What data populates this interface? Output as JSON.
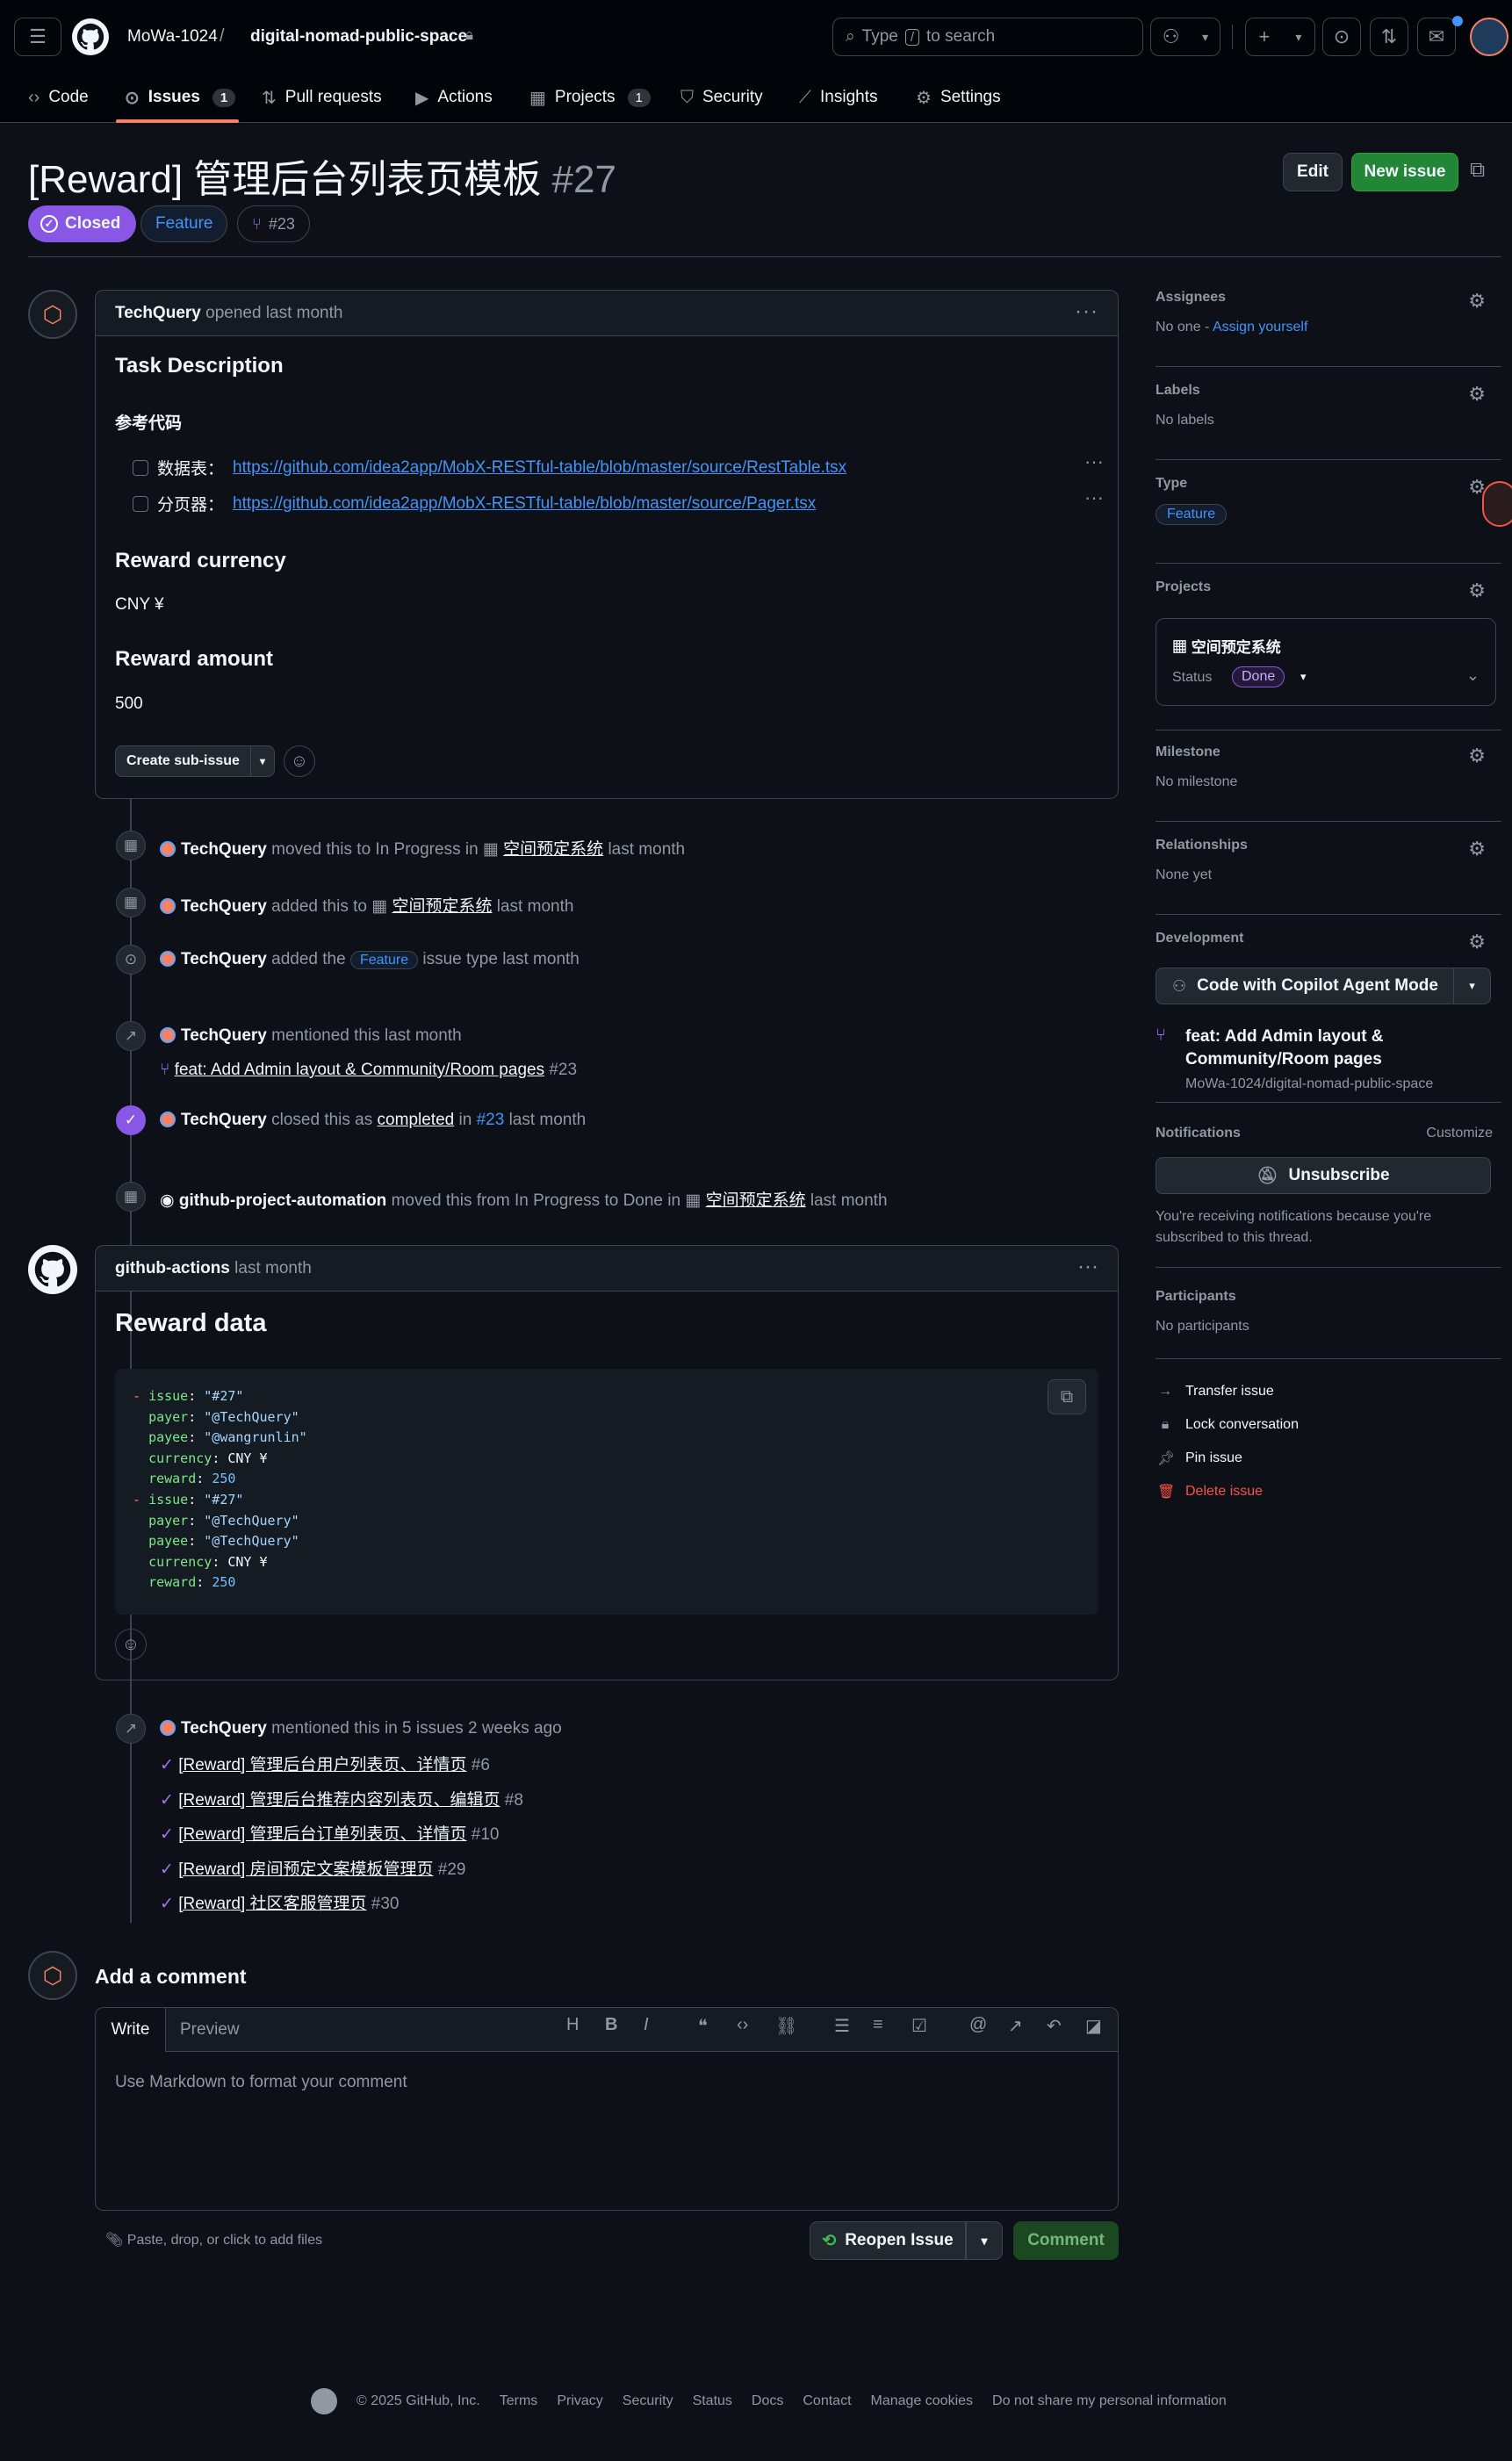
{
  "header": {
    "owner": "MoWa-1024",
    "separator": "/",
    "repo": "digital-nomad-public-space",
    "search_prefix": "Type",
    "search_key": "/",
    "search_suffix": "to search"
  },
  "tabs": [
    {
      "label": "Code",
      "icon": "code-icon"
    },
    {
      "label": "Issues",
      "count": "1",
      "icon": "issue-icon"
    },
    {
      "label": "Pull requests",
      "icon": "pr-icon"
    },
    {
      "label": "Actions",
      "icon": "play-icon"
    },
    {
      "label": "Projects",
      "count": "1",
      "icon": "table-icon"
    },
    {
      "label": "Security",
      "icon": "shield-icon"
    },
    {
      "label": "Insights",
      "icon": "graph-icon"
    },
    {
      "label": "Settings",
      "icon": "gear-icon"
    }
  ],
  "issue": {
    "title": "[Reward] 管理后台列表页模板",
    "number": "#27",
    "state": "Closed",
    "type_label": "Feature",
    "linked_pr": "#23",
    "edit_label": "Edit",
    "new_issue_label": "New issue"
  },
  "first_comment": {
    "author": "TechQuery",
    "meta": "opened last month",
    "h_task": "Task Description",
    "h_ref": "参考代码",
    "tasks": [
      {
        "label": "数据表：",
        "url": "https://github.com/idea2app/MobX-RESTful-table/blob/master/source/RestTable.tsx"
      },
      {
        "label": "分页器：",
        "url": "https://github.com/idea2app/MobX-RESTful-table/blob/master/source/Pager.tsx"
      }
    ],
    "h_currency": "Reward currency",
    "currency": "CNY ¥",
    "h_amount": "Reward amount",
    "amount": "500",
    "sub_issue_label": "Create sub-issue"
  },
  "timeline": {
    "ev1": {
      "actor": "TechQuery",
      "pre": "moved this to In Progress in",
      "project": "空间预定系统",
      "post": "last month"
    },
    "ev2": {
      "actor": "TechQuery",
      "pre": "added this to",
      "project": "空间预定系统",
      "post": "last month"
    },
    "ev3": {
      "actor": "TechQuery",
      "pre": "added the",
      "badge": "Feature",
      "post": "issue type last month"
    },
    "ev4": {
      "actor": "TechQuery",
      "pre": "mentioned this last month",
      "pr_title": "feat: Add Admin layout & Community/Room pages",
      "pr_num": "#23"
    },
    "ev5": {
      "actor": "TechQuery",
      "pre": "closed this as",
      "completed": "completed",
      "in": "in",
      "ref": "#23",
      "post": "last month"
    },
    "ev6": {
      "actor": "github-project-automation",
      "pre": "moved this from In Progress to Done in",
      "project": "空间预定系统",
      "post": "last month"
    },
    "ev7": {
      "actor": "TechQuery",
      "pre": "mentioned this in 5 issues 2 weeks ago"
    }
  },
  "mentions": [
    {
      "title": "[Reward] 管理后台用户列表页、详情页",
      "num": "#6"
    },
    {
      "title": "[Reward] 管理后台推荐内容列表页、编辑页",
      "num": "#8"
    },
    {
      "title": "[Reward] 管理后台订单列表页、详情页",
      "num": "#10"
    },
    {
      "title": "[Reward] 房间预定文案模板管理页",
      "num": "#29"
    },
    {
      "title": "[Reward] 社区客服管理页",
      "num": "#30"
    }
  ],
  "bot_comment": {
    "author": "github-actions",
    "meta": "last month",
    "heading": "Reward data",
    "code_lines": [
      {
        "dash": "- ",
        "key": "issue",
        "val": "\"#27\""
      },
      {
        "dash": "  ",
        "key": "payer",
        "val": "\"@TechQuery\""
      },
      {
        "dash": "  ",
        "key": "payee",
        "val": "\"@wangrunlin\""
      },
      {
        "dash": "  ",
        "key": "currency",
        "val": "CNY ¥"
      },
      {
        "dash": "  ",
        "key": "reward",
        "val": "250"
      },
      {
        "dash": "- ",
        "key": "issue",
        "val": "\"#27\""
      },
      {
        "dash": "  ",
        "key": "payer",
        "val": "\"@TechQuery\""
      },
      {
        "dash": "  ",
        "key": "payee",
        "val": "\"@TechQuery\""
      },
      {
        "dash": "  ",
        "key": "currency",
        "val": "CNY ¥"
      },
      {
        "dash": "  ",
        "key": "reward",
        "val": "250"
      }
    ]
  },
  "add_comment": {
    "heading": "Add a comment",
    "tab_write": "Write",
    "tab_preview": "Preview",
    "placeholder": "Use Markdown to format your comment",
    "attach": "Paste, drop, or click to add files",
    "reopen": "Reopen Issue",
    "comment": "Comment"
  },
  "sidebar": {
    "assignees_h": "Assignees",
    "assignees_v": "No one -",
    "assign_yourself": "Assign yourself",
    "labels_h": "Labels",
    "labels_v": "No labels",
    "type_h": "Type",
    "type_v": "Feature",
    "projects_h": "Projects",
    "project_name": "空间预定系统",
    "status_label": "Status",
    "status_value": "Done",
    "milestone_h": "Milestone",
    "milestone_v": "No milestone",
    "relationships_h": "Relationships",
    "relationships_v": "None yet",
    "development_h": "Development",
    "copilot_label": "Code with Copilot Agent Mode",
    "dev_pr_title": "feat: Add Admin layout & Community/Room pages",
    "dev_pr_repo": "MoWa-1024/digital-nomad-public-space",
    "notifications_h": "Notifications",
    "customize": "Customize",
    "unsubscribe": "Unsubscribe",
    "notif_reason": "You're receiving notifications because you're subscribed to this thread.",
    "participants_h": "Participants",
    "participants_v": "No participants",
    "actions": [
      {
        "label": "Transfer issue",
        "icon": "arrow-right-icon"
      },
      {
        "label": "Lock conversation",
        "icon": "lock-icon"
      },
      {
        "label": "Pin issue",
        "icon": "pin-icon"
      },
      {
        "label": "Delete issue",
        "icon": "trash-icon"
      }
    ]
  },
  "footer": {
    "copyright": "© 2025 GitHub, Inc.",
    "links": [
      "Terms",
      "Privacy",
      "Security",
      "Status",
      "Docs",
      "Contact",
      "Manage cookies",
      "Do not share my personal information"
    ]
  },
  "colors": {
    "closed": "#8957e5",
    "green": "#238636",
    "accent": "#4493f8",
    "danger": "#f85149"
  }
}
